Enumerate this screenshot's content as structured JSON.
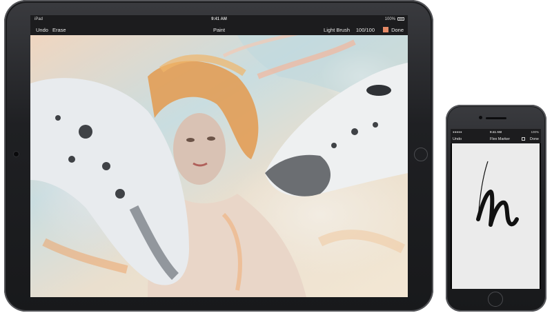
{
  "ipad": {
    "status_left": "iPad",
    "status_time": "9:41 AM",
    "status_battery": "100%",
    "toolbar": {
      "undo_label": "Undo",
      "erase_label": "Erase",
      "title": "Paint",
      "brush_label": "Light Brush",
      "brush_size": "100/100",
      "color_swatch": "#e58a66",
      "done_label": "Done"
    }
  },
  "iphone": {
    "status_time": "9:41 AM",
    "status_battery": "100%",
    "toolbar": {
      "undo_label": "Undo",
      "brush_label": "Flex Marker",
      "done_label": "Done"
    }
  },
  "colors": {
    "device_frame": "#1f2023",
    "toolbar_bg": "#1c1c1e",
    "toolbar_text": "#e8e8e8",
    "phone_canvas": "#ebebeb",
    "ink": "#111111"
  }
}
